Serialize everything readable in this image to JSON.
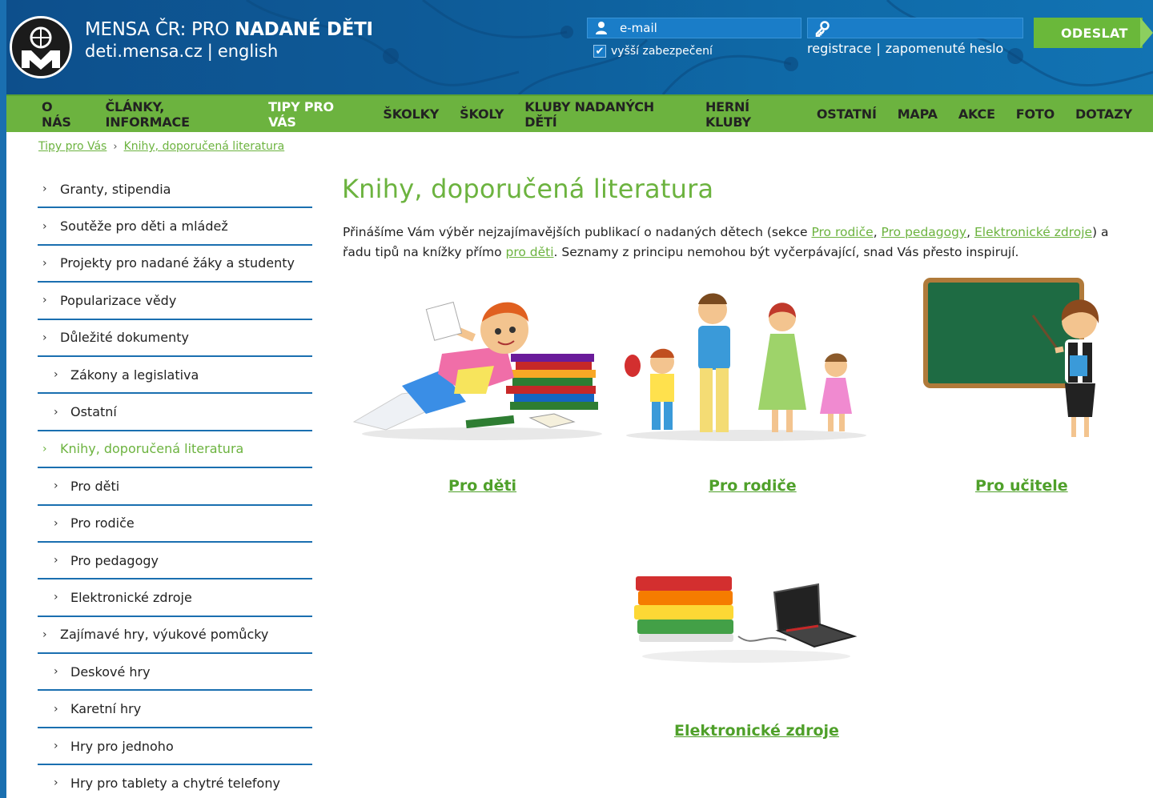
{
  "header": {
    "title_prefix": "MENSA ČR: PRO ",
    "title_bold": "NADANÉ DĚTI",
    "domain": "deti.mensa.cz",
    "separator": "|",
    "language": "english",
    "email_placeholder": "e-mail",
    "secure_label": "vyšší zabezpečení",
    "register": "registrace",
    "forgot": "zapomenuté heslo",
    "submit": "ODESLAT"
  },
  "nav": {
    "items": [
      "O NÁS",
      "ČLÁNKY, INFORMACE",
      "TIPY PRO VÁS",
      "ŠKOLKY",
      "ŠKOLY",
      "KLUBY NADANÝCH DĚTÍ",
      "HERNÍ KLUBY",
      "OSTATNÍ",
      "MAPA",
      "AKCE",
      "FOTO",
      "DOTAZY"
    ]
  },
  "breadcrumb": {
    "items": [
      "Tipy pro Vás",
      "Knihy, doporučená literatura"
    ]
  },
  "sidebar": {
    "items": [
      "Granty, stipendia",
      "Soutěže pro děti a mládež",
      "Projekty pro nadané žáky a studenty",
      "Popularizace vědy",
      "Důležité dokumenty",
      "Zákony a legislativa",
      "Ostatní",
      "Knihy, doporučená literatura",
      "Pro děti",
      "Pro rodiče",
      "Pro pedagogy",
      "Elektronické zdroje",
      "Zajímavé hry, výukové pomůcky",
      "Deskové hry",
      "Karetní hry",
      "Hry pro jednoho",
      "Hry pro tablety a chytré telefony"
    ]
  },
  "main": {
    "title": "Knihy, doporučená literatura",
    "intro_1": "Přinášíme Vám výběr nejzajímavějších publikací o nadaných dětech (sekce ",
    "link_rodice": "Pro rodiče",
    "comma": ", ",
    "link_pedagogy": "Pro pedagogy",
    "link_zdroje": "Elektronické zdroje",
    "intro_2": ") a řadu tipů na knížky přímo ",
    "link_deti": "pro děti",
    "intro_3": ". Seznamy z principu nemohou být vyčerpávající, snad Vás přesto inspirují.",
    "cards": [
      "Pro děti",
      "Pro rodiče",
      "Pro učitele",
      "Elektronické zdroje"
    ]
  },
  "icons": [
    "user-icon",
    "key-icon",
    "check-icon",
    "mensa-logo-icon",
    "chevron-right-icon"
  ],
  "colors": {
    "accent_green": "#6cb33f",
    "header_blue": "#0e5c99",
    "divider_blue": "#1a6fb0"
  }
}
